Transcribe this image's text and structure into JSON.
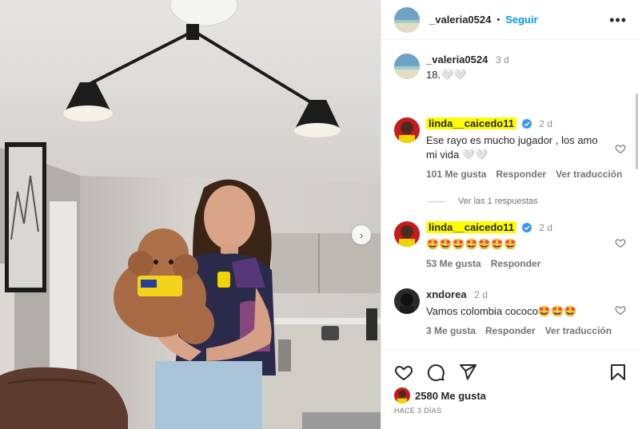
{
  "photo": {
    "next_glyph": "›"
  },
  "header": {
    "username": "_valeria0524",
    "separator": "•",
    "follow_label": "Seguir",
    "more_glyph": "•••"
  },
  "caption": {
    "username": "_valeria0524",
    "time": "3 d",
    "text": "18.🤍🤍"
  },
  "comments": [
    {
      "username": "linda__caicedo11",
      "verified": true,
      "time": "2 d",
      "text": "Ese rayo es mucho jugador , los amo mi vida 🤍🤍",
      "likes": "101 Me gusta",
      "reply": "Responder",
      "translate": "Ver traducción"
    },
    {
      "username": "linda__caicedo11",
      "verified": true,
      "time": "2 d",
      "text": "🤩🤩🤩🤩🤩🤩🤩",
      "likes": "53 Me gusta",
      "reply": "Responder"
    },
    {
      "username": "xndorea",
      "verified": false,
      "time": "2 d",
      "text": "Vamos colombia cococo🤩🤩🤩",
      "likes": "3 Me gusta",
      "reply": "Responder",
      "translate": "Ver traducción"
    }
  ],
  "replies_link": "Ver las 1 respuestas",
  "footer": {
    "likes": "2580 Me gusta",
    "date": "HACE 3 DÍAS"
  },
  "icons": {
    "like": "heart-icon",
    "comment": "comment-icon",
    "share": "share-icon",
    "save": "bookmark-icon"
  },
  "colors": {
    "accent": "#0095f6",
    "highlight": "#fffc02",
    "verified": "#3897f0"
  }
}
